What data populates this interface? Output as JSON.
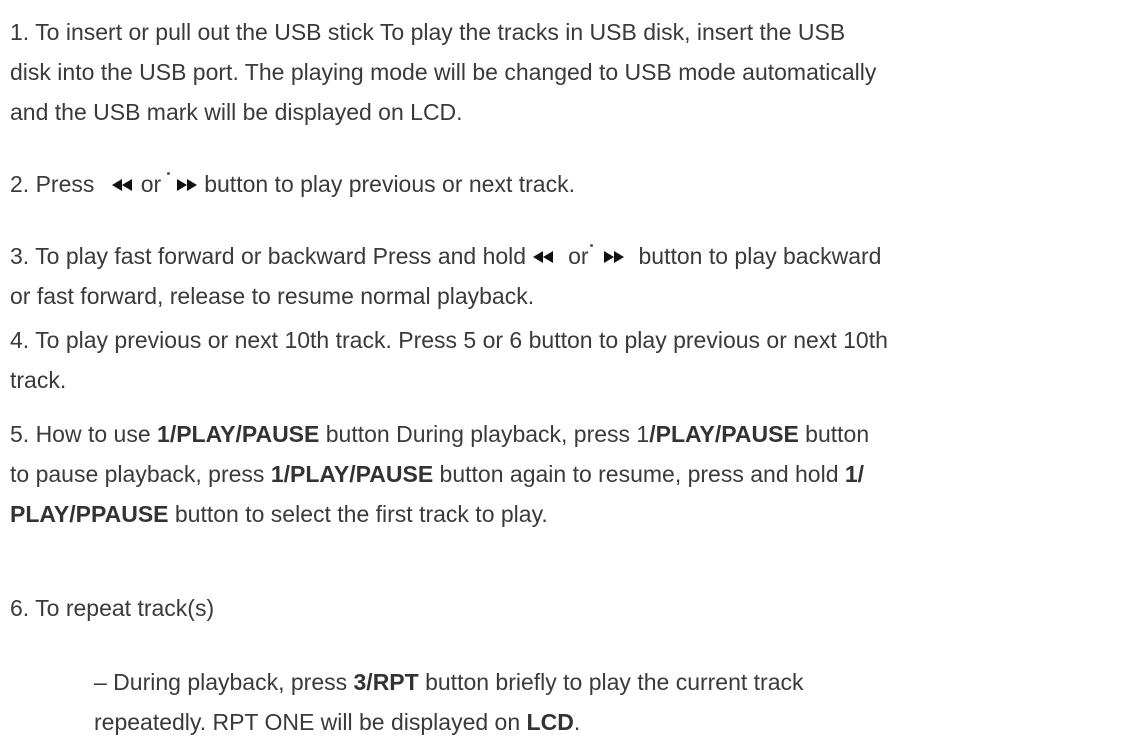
{
  "p1": {
    "line1": "1. To insert or pull out the USB stick To play the tracks in USB disk, insert the USB",
    "line2": "disk into the USB port. The playing mode will be changed to USB mode automatically",
    "line3": "and the USB mark will be displayed on LCD."
  },
  "p2": {
    "prefix": "2. Press ",
    "or": "or",
    "suffix": "button to play previous or next track."
  },
  "p3": {
    "prefix": "3. To play fast forward or backward Press and hold",
    "or": "or",
    "suffix": "button to play backward",
    "line2": "or fast forward, release to resume normal playback."
  },
  "p4": {
    "line1": "4. To play previous or next 10th track. Press 5 or 6 button to play previous or next 10th",
    "line2": "track."
  },
  "p5": {
    "t1": "5. How to use ",
    "b1": "1/PLAY/PAUSE",
    "t2": " button During playback, press 1",
    "b2": "/PLAY/PAUSE",
    "t3": " button",
    "t4": "to pause playback, press ",
    "b3": "1/PLAY/PAUSE",
    "t5": " button again to resume, press and hold ",
    "b4": "1/",
    "b5": "PLAY/PPAUSE",
    "t6": " button to select the first track to play."
  },
  "p6": {
    "line1": "6. To repeat track(s)"
  },
  "p7": {
    "t1": "– During playback, press ",
    "b1": "3/RPT",
    "t2": " button briefly to play the current track",
    "t3": "repeatedly. RPT ONE will be displayed on ",
    "b2": "LCD",
    "t4": "."
  },
  "icons": {
    "previous": "rewind-icon",
    "next": "fast-forward-icon"
  },
  "colors": {
    "text": "#3a3a3a",
    "icon": "#111111"
  }
}
